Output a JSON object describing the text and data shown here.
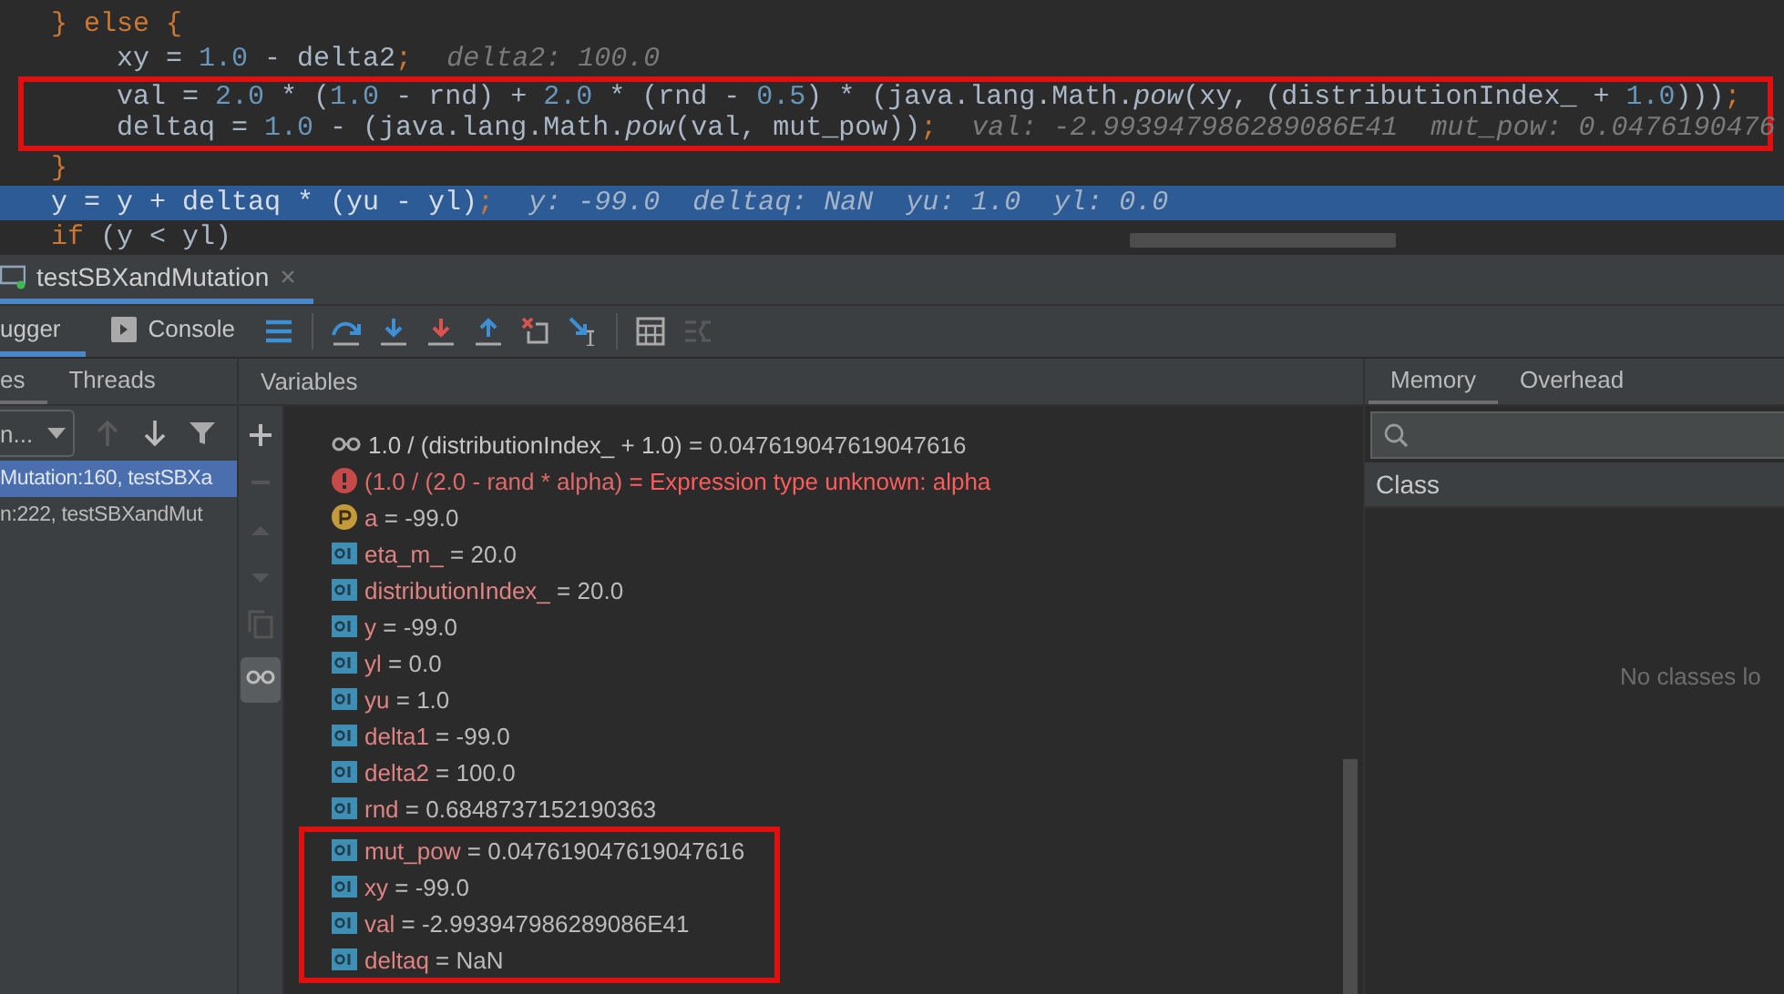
{
  "editor": {
    "lines": [
      {
        "current": false,
        "boxed": false,
        "tokens": [
          {
            "kind": "keyword",
            "text": "} else {"
          }
        ]
      },
      {
        "current": false,
        "boxed": false,
        "tokens": [
          {
            "kind": "code",
            "text": "    xy = "
          },
          {
            "kind": "number",
            "text": "1.0"
          },
          {
            "kind": "code",
            "text": " - delta2"
          },
          {
            "kind": "keyword",
            "text": ";"
          }
        ],
        "hint": "delta2: 100.0"
      },
      {
        "current": false,
        "boxed": true,
        "tokens": [
          {
            "kind": "code",
            "text": "    val = "
          },
          {
            "kind": "number",
            "text": "2.0"
          },
          {
            "kind": "code",
            "text": " * ("
          },
          {
            "kind": "number",
            "text": "1.0"
          },
          {
            "kind": "code",
            "text": " - rnd) + "
          },
          {
            "kind": "number",
            "text": "2.0"
          },
          {
            "kind": "code",
            "text": " * (rnd - "
          },
          {
            "kind": "number",
            "text": "0.5"
          },
          {
            "kind": "code",
            "text": ") * (java.lang.Math."
          },
          {
            "kind": "method",
            "text": "pow"
          },
          {
            "kind": "code",
            "text": "(xy, (distributionIndex_ + "
          },
          {
            "kind": "number",
            "text": "1.0"
          },
          {
            "kind": "code",
            "text": ")))"
          },
          {
            "kind": "keyword",
            "text": ";"
          }
        ]
      },
      {
        "current": false,
        "boxed": true,
        "tokens": [
          {
            "kind": "code",
            "text": "    deltaq = "
          },
          {
            "kind": "number",
            "text": "1.0"
          },
          {
            "kind": "code",
            "text": " - (java.lang.Math."
          },
          {
            "kind": "method",
            "text": "pow"
          },
          {
            "kind": "code",
            "text": "(val, mut_pow))"
          },
          {
            "kind": "keyword",
            "text": ";"
          }
        ],
        "hint": "val: -2.993947986289086E41  mut_pow: 0.0476190476"
      },
      {
        "current": false,
        "boxed": false,
        "tokens": [
          {
            "kind": "keyword",
            "text": "}"
          }
        ]
      },
      {
        "current": true,
        "boxed": false,
        "tokens": [
          {
            "kind": "code",
            "text": "y = y + deltaq * (yu - yl)"
          },
          {
            "kind": "keyword",
            "text": ";"
          }
        ],
        "hint": "y: -99.0  deltaq: NaN  yu: 1.0  yl: 0.0"
      },
      {
        "current": false,
        "boxed": false,
        "tokens": [
          {
            "kind": "keyword",
            "text": "if"
          },
          {
            "kind": "code",
            "text": " (y < yl)"
          }
        ]
      }
    ]
  },
  "run_tab": {
    "label": "testSBXandMutation",
    "close": "×",
    "selected": true
  },
  "toolbar": {
    "tabs": [
      {
        "label": "ugger",
        "selected": true
      },
      {
        "label": "Console",
        "selected": false
      }
    ]
  },
  "frames_panel": {
    "tabs": [
      {
        "label": "es",
        "selected": true
      },
      {
        "label": "Threads",
        "selected": false
      }
    ],
    "thread_dropdown": "n...",
    "frames": [
      {
        "label": "Mutation:160, testSBXa",
        "selected": true
      },
      {
        "label": "n:222, testSBXandMut",
        "selected": false
      }
    ]
  },
  "variables_panel": {
    "title": "Variables",
    "rows": [
      {
        "kind": "watch",
        "name": "1.0 / (distributionIndex_ + 1.0)",
        "eq": "=",
        "value": "0.047619047619047616",
        "boxed": false
      },
      {
        "kind": "error",
        "name": "(1.0 / (2.0 - rand * alpha)",
        "eq": "=",
        "value": "Expression type unknown: alpha",
        "boxed": false
      },
      {
        "kind": "parameter",
        "name": "a",
        "eq": "=",
        "value": "-99.0",
        "boxed": false
      },
      {
        "kind": "field",
        "name": "eta_m_",
        "eq": "=",
        "value": "20.0",
        "boxed": false
      },
      {
        "kind": "field",
        "name": "distributionIndex_",
        "eq": "=",
        "value": "20.0",
        "boxed": false
      },
      {
        "kind": "field",
        "name": "y",
        "eq": "=",
        "value": "-99.0",
        "boxed": false
      },
      {
        "kind": "field",
        "name": "yl",
        "eq": "=",
        "value": "0.0",
        "boxed": false
      },
      {
        "kind": "field",
        "name": "yu",
        "eq": "=",
        "value": "1.0",
        "boxed": false
      },
      {
        "kind": "field",
        "name": "delta1",
        "eq": "=",
        "value": "-99.0",
        "boxed": false
      },
      {
        "kind": "field",
        "name": "delta2",
        "eq": "=",
        "value": "100.0",
        "boxed": false
      },
      {
        "kind": "field",
        "name": "rnd",
        "eq": "=",
        "value": "0.6848737152190363",
        "boxed": false
      },
      {
        "kind": "field",
        "name": "mut_pow",
        "eq": "=",
        "value": "0.047619047619047616",
        "boxed": true
      },
      {
        "kind": "field",
        "name": "xy",
        "eq": "=",
        "value": "-99.0",
        "boxed": true
      },
      {
        "kind": "field",
        "name": "val",
        "eq": "=",
        "value": "-2.993947986289086E41",
        "boxed": true
      },
      {
        "kind": "field",
        "name": "deltaq",
        "eq": "=",
        "value": "NaN",
        "boxed": true
      }
    ]
  },
  "memory_panel": {
    "tabs": [
      {
        "label": "Memory",
        "selected": true
      },
      {
        "label": "Overhead",
        "selected": false
      }
    ],
    "column": "Class",
    "empty_text": "No classes lo"
  }
}
